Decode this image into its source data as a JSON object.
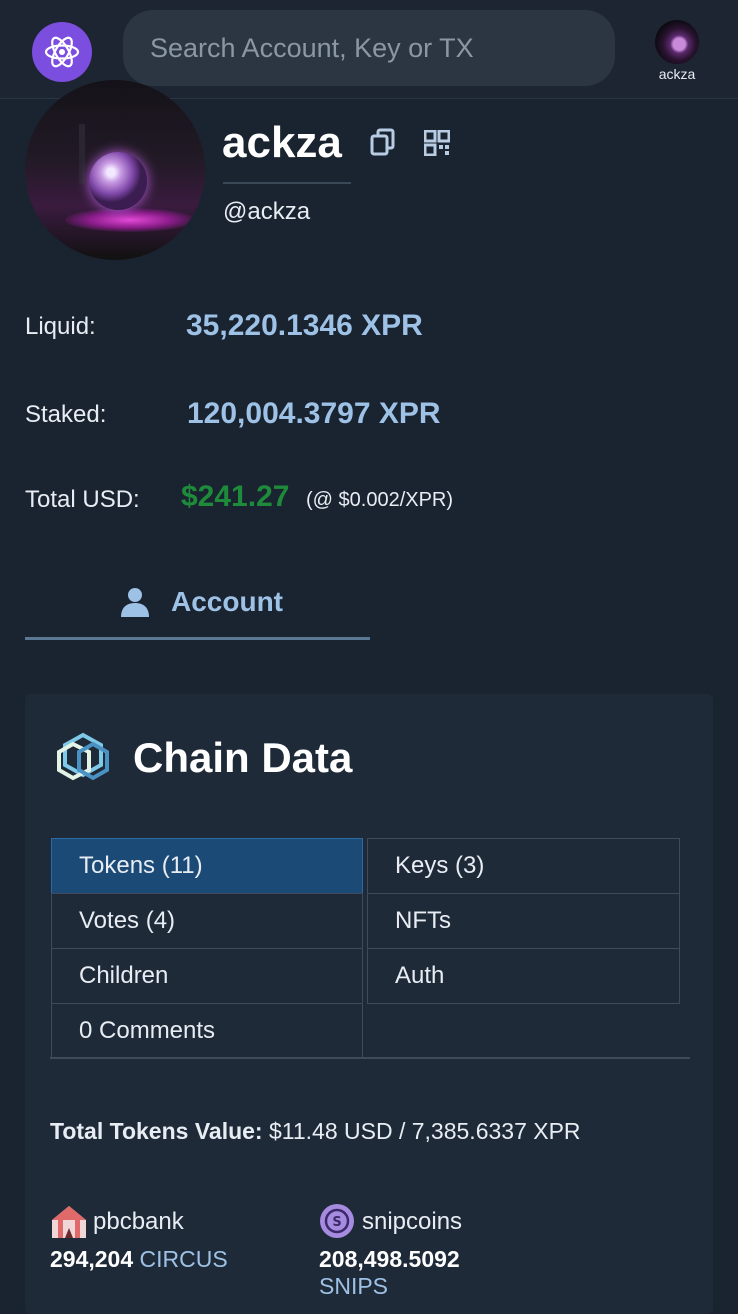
{
  "header": {
    "search_placeholder": "Search Account, Key or TX",
    "user": "ackza"
  },
  "profile": {
    "display_name": "ackza",
    "handle": "@ackza"
  },
  "balances": {
    "liquid_label": "Liquid:",
    "liquid_value": "35,220.1346 XPR",
    "staked_label": "Staked:",
    "staked_value": "120,004.3797 XPR",
    "total_label": "Total USD:",
    "total_value": "$241.27",
    "rate": "(@ $0.002/XPR)"
  },
  "tabs": {
    "account": "Account"
  },
  "chain_data": {
    "title": "Chain Data",
    "buttons": {
      "tokens": "Tokens (11)",
      "keys": "Keys (3)",
      "votes": "Votes (4)",
      "nfts": "NFTs",
      "children": "Children",
      "auth": "Auth",
      "comments": "0 Comments"
    },
    "total_label": "Total Tokens Value:",
    "total_value": "$11.48 USD / 7,385.6337 XPR",
    "tokens": [
      {
        "name": "pbcbank",
        "amount": "294,204",
        "symbol": "CIRCUS",
        "icon": "circus-tent-icon"
      },
      {
        "name": "snipcoins",
        "amount": "208,498.5092",
        "symbol": "SNIPS",
        "icon": "snipcoins-icon"
      }
    ]
  },
  "colors": {
    "accent": "#9ec1e6",
    "usd_green": "#1e8b3a",
    "active_tab": "#1b4a76",
    "logo_purple": "#7b4ee0"
  }
}
